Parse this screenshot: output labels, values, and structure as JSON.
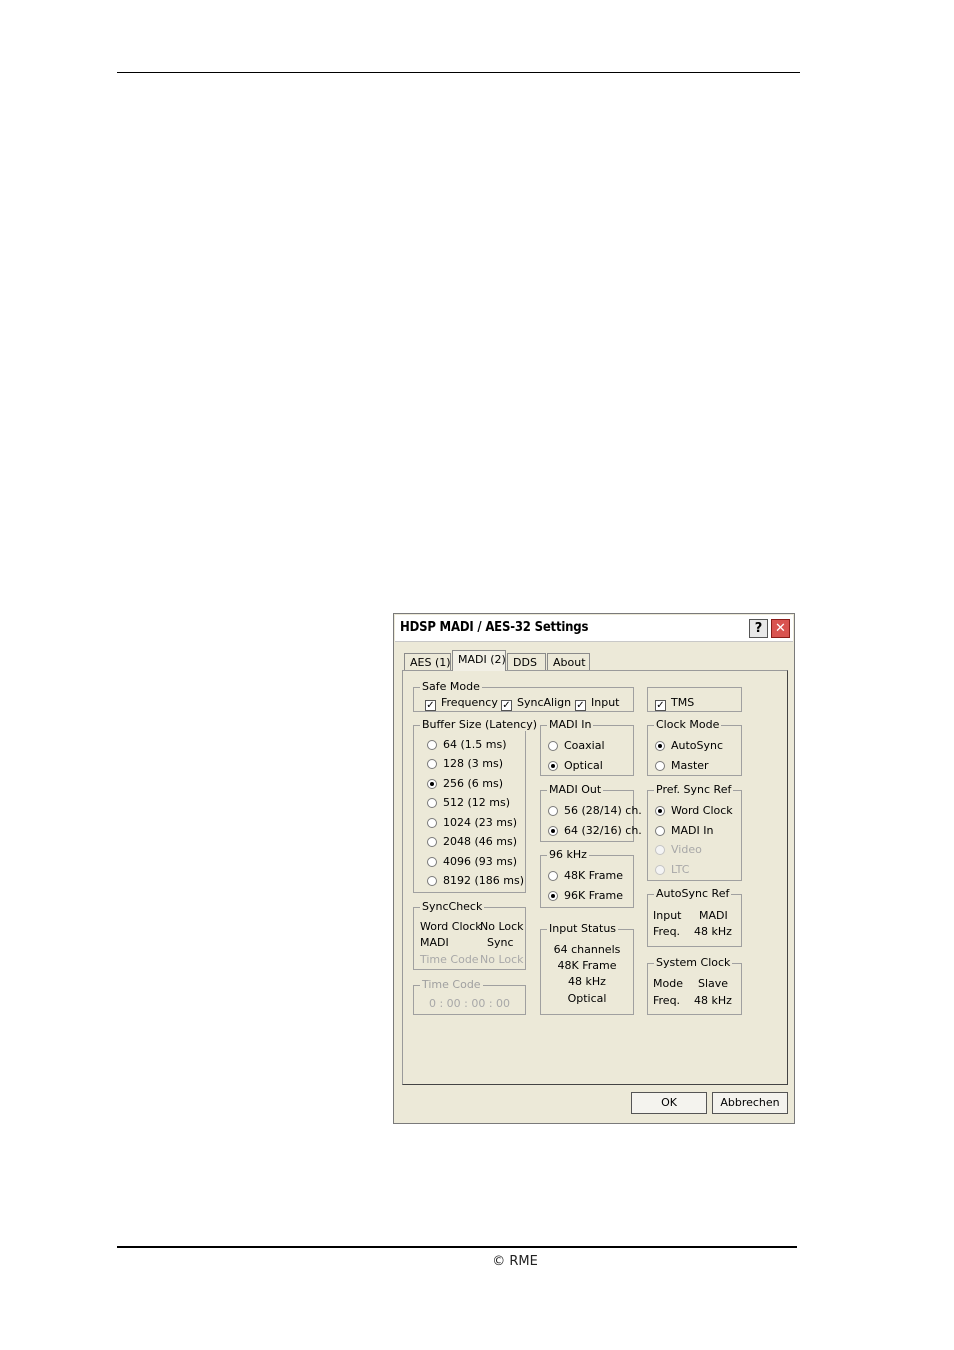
{
  "footer": {
    "copyright": "© RME"
  },
  "dialog": {
    "title": "HDSP MADI / AES-32 Settings",
    "help_label": "?",
    "close_label": "✕",
    "tabs": [
      {
        "label": "AES (1)"
      },
      {
        "label": "MADI (2)"
      },
      {
        "label": "DDS"
      },
      {
        "label": "About"
      }
    ],
    "safe_mode": {
      "legend": "Safe Mode",
      "items": [
        {
          "label": "Frequency",
          "checked": true
        },
        {
          "label": "SyncAlign",
          "checked": true
        },
        {
          "label": "Input",
          "checked": true
        }
      ]
    },
    "tms": {
      "label": "TMS",
      "checked": true
    },
    "buffer_size": {
      "legend": "Buffer Size (Latency)",
      "options": [
        "64 (1.5 ms)",
        "128 (3 ms)",
        "256 (6 ms)",
        "512 (12 ms)",
        "1024 (23 ms)",
        "2048 (46 ms)",
        "4096 (93 ms)",
        "8192 (186 ms)"
      ],
      "selected": "256 (6 ms)"
    },
    "madi_in": {
      "legend": "MADI In",
      "options": [
        "Coaxial",
        "Optical"
      ],
      "selected": "Optical"
    },
    "clock_mode": {
      "legend": "Clock Mode",
      "options": [
        "AutoSync",
        "Master"
      ],
      "selected": "AutoSync"
    },
    "madi_out": {
      "legend": "MADI Out",
      "options": [
        "56 (28/14) ch.",
        "64 (32/16) ch."
      ],
      "selected": "64 (32/16) ch."
    },
    "pref_sync_ref": {
      "legend": "Pref. Sync Ref",
      "options": [
        "Word Clock",
        "MADI In",
        "Video",
        "LTC"
      ],
      "selected": "Word Clock"
    },
    "khz96": {
      "legend": "96 kHz",
      "options": [
        "48K Frame",
        "96K Frame"
      ],
      "selected": "96K Frame"
    },
    "synccheck": {
      "legend": "SyncCheck",
      "rows": [
        {
          "name": "Word Clock",
          "value": "No Lock"
        },
        {
          "name": "MADI",
          "value": "Sync"
        },
        {
          "name": "Time Code",
          "value": "No Lock"
        }
      ]
    },
    "autosync_ref": {
      "legend": "AutoSync Ref",
      "input_label": "Input",
      "input_value": "MADI",
      "freq_label": "Freq.",
      "freq_value": "48 kHz"
    },
    "input_status": {
      "legend": "Input Status",
      "lines": [
        "64 channels",
        "48K Frame",
        "48 kHz",
        "Optical"
      ]
    },
    "time_code": {
      "legend": "Time Code",
      "value": "0 : 00 : 00 : 00"
    },
    "system_clock": {
      "legend": "System Clock",
      "mode_label": "Mode",
      "mode_value": "Slave",
      "freq_label": "Freq.",
      "freq_value": "48 kHz"
    },
    "ok_label": "OK",
    "cancel_label": "Abbrechen"
  }
}
